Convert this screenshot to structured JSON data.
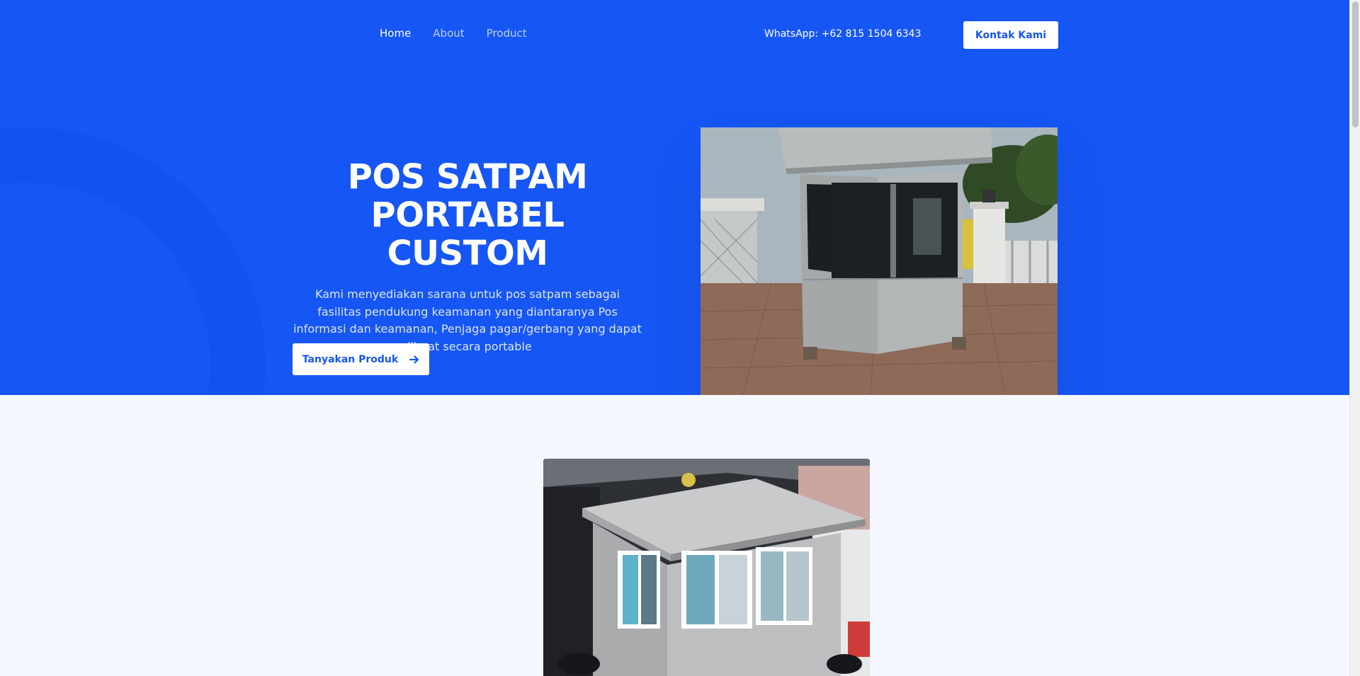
{
  "nav": {
    "links": [
      "Home",
      "About",
      "Product"
    ],
    "whatsapp": "WhatsApp: +62 815 1504 6343",
    "contact_label": "Kontak Kami"
  },
  "hero": {
    "title_line1": "POS SATPAM",
    "title_line2": "PORTABEL CUSTOM",
    "description": "Kami menyediakan sarana untuk pos satpam sebagai fasilitas pendukung keamanan yang diantaranya Pos informasi dan keamanan, Penjaga pagar/gerbang yang dapat dibuat secara portable",
    "cta_label": "Tanyakan Produk",
    "cta_icon": "arrow-right-icon"
  },
  "colors": {
    "primary": "#1656f5",
    "page_bg": "#f4f7fe",
    "button_bg": "#ffffff"
  }
}
